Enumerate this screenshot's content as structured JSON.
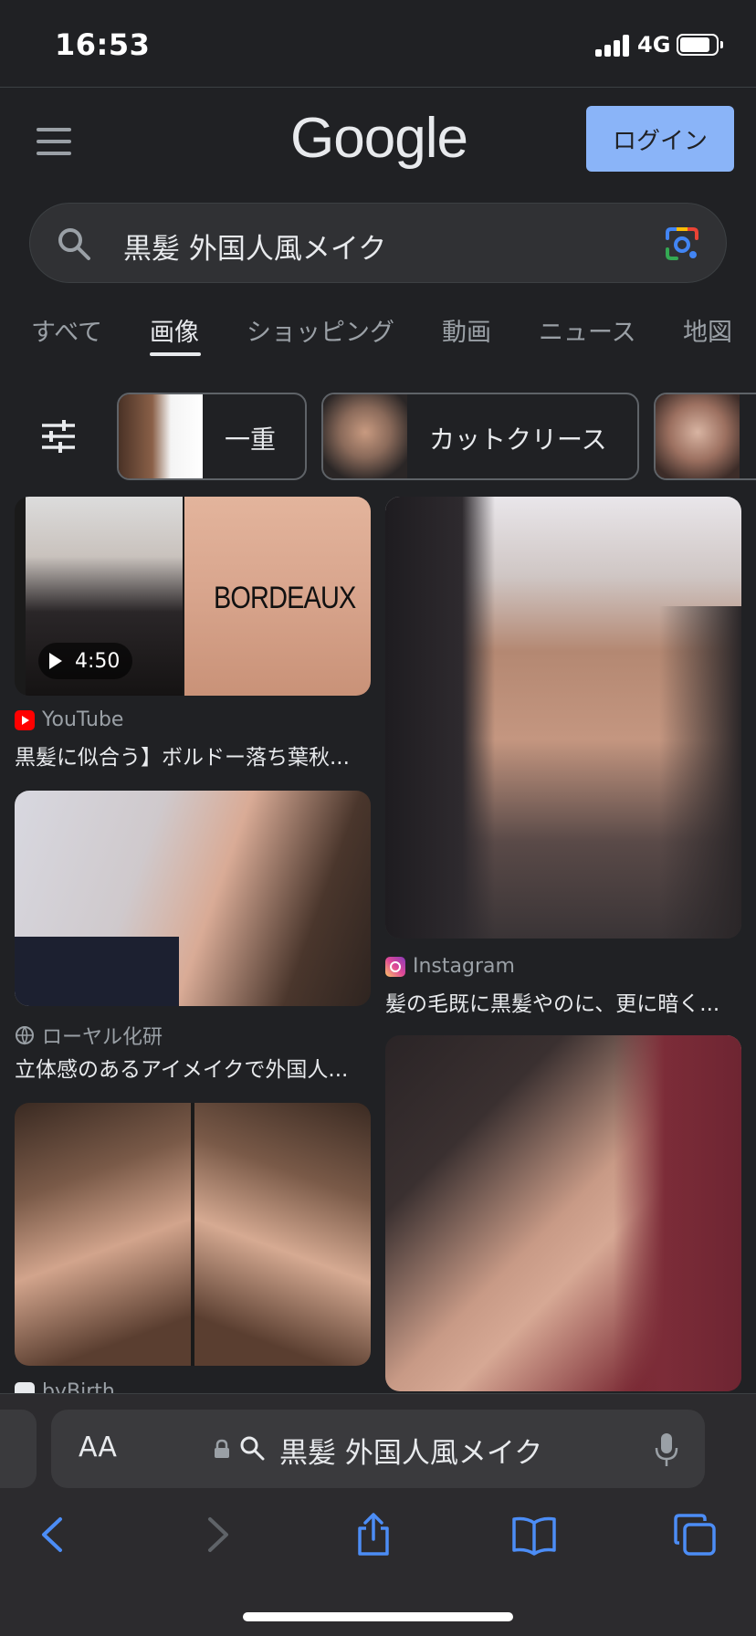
{
  "status": {
    "time": "16:53",
    "network": "4G"
  },
  "header": {
    "logo": "Google",
    "login_label": "ログイン"
  },
  "search": {
    "query": "黒髪 外国人風メイク"
  },
  "tabs": [
    {
      "label": "すべて",
      "active": false
    },
    {
      "label": "画像",
      "active": true
    },
    {
      "label": "ショッピング",
      "active": false
    },
    {
      "label": "動画",
      "active": false
    },
    {
      "label": "ニュース",
      "active": false
    },
    {
      "label": "地図",
      "active": false
    }
  ],
  "chips": [
    {
      "label": "一重"
    },
    {
      "label": "カットクリース"
    },
    {
      "label": ""
    }
  ],
  "results": [
    {
      "source": "YouTube",
      "caption": "黒髪に似合う】ボルドー落ち葉秋...",
      "duration": "4:50",
      "overlay_text": "BORDEAUX"
    },
    {
      "source": "Instagram",
      "caption": "髪の毛既に黒髪やのに、更に暗く..."
    },
    {
      "source": "ローヤル化研",
      "caption": "立体感のあるアイメイクで外国人..."
    },
    {
      "source": "byBirth",
      "caption": ""
    }
  ],
  "browser": {
    "aa_label": "AA",
    "url_text": "黒髪 外国人風メイク"
  },
  "colors": {
    "background": "#202124",
    "accent": "#8ab4f8",
    "youtube": "#ff0000"
  }
}
